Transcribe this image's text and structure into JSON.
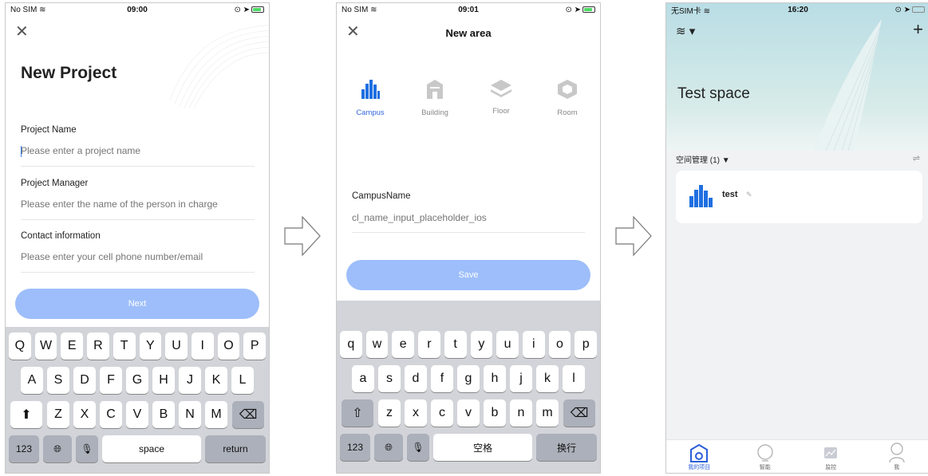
{
  "screen1": {
    "status": {
      "carrier": "No SIM",
      "time": "09:00"
    },
    "title": "New Project",
    "fields": [
      {
        "label": "Project Name",
        "placeholder": "Please enter a project name"
      },
      {
        "label": "Project Manager",
        "placeholder": "Please enter the name of the person in charge"
      },
      {
        "label": "Contact information",
        "placeholder": "Please enter your cell phone number/email"
      }
    ],
    "next_label": "Next",
    "keyboard": {
      "row1": [
        "Q",
        "W",
        "E",
        "R",
        "T",
        "Y",
        "U",
        "I",
        "O",
        "P"
      ],
      "row2": [
        "A",
        "S",
        "D",
        "F",
        "G",
        "H",
        "J",
        "K",
        "L"
      ],
      "row3": [
        "Z",
        "X",
        "C",
        "V",
        "B",
        "N",
        "M"
      ],
      "numbers": "123",
      "space": "space",
      "return": "return"
    }
  },
  "screen2": {
    "status": {
      "carrier": "No SIM",
      "time": "09:01"
    },
    "nav_title": "New area",
    "categories": [
      {
        "label": "Campus",
        "icon": "campus-icon",
        "active": true
      },
      {
        "label": "Building",
        "icon": "building-icon",
        "active": false
      },
      {
        "label": "Floor",
        "icon": "floor-icon",
        "active": false
      },
      {
        "label": "Room",
        "icon": "room-icon",
        "active": false
      }
    ],
    "field_label": "CampusName",
    "field_placeholder": "cl_name_input_placeholder_ios",
    "save_label": "Save",
    "keyboard": {
      "row1": [
        "q",
        "w",
        "e",
        "r",
        "t",
        "y",
        "u",
        "i",
        "o",
        "p"
      ],
      "row2": [
        "a",
        "s",
        "d",
        "f",
        "g",
        "h",
        "j",
        "k",
        "l"
      ],
      "row3": [
        "z",
        "x",
        "c",
        "v",
        "b",
        "n",
        "m"
      ],
      "numbers": "123",
      "space": "空格",
      "return": "换行"
    }
  },
  "screen3": {
    "status": {
      "carrier": "无SIM卡",
      "time": "16:20"
    },
    "title": "Test space",
    "section": "空间管理 (1) ▼",
    "item_name": "test",
    "tabs": [
      {
        "label": "我的项目",
        "icon": "project-home-icon",
        "active": true
      },
      {
        "label": "智能",
        "icon": "bulb-icon",
        "active": false
      },
      {
        "label": "监控",
        "icon": "chart-icon",
        "active": false
      },
      {
        "label": "我",
        "icon": "user-icon",
        "active": false
      }
    ]
  },
  "colors": {
    "accent": "#2b5fd9",
    "button_disabled": "#9dbefa",
    "keyboard_bg": "#d2d4d9"
  }
}
